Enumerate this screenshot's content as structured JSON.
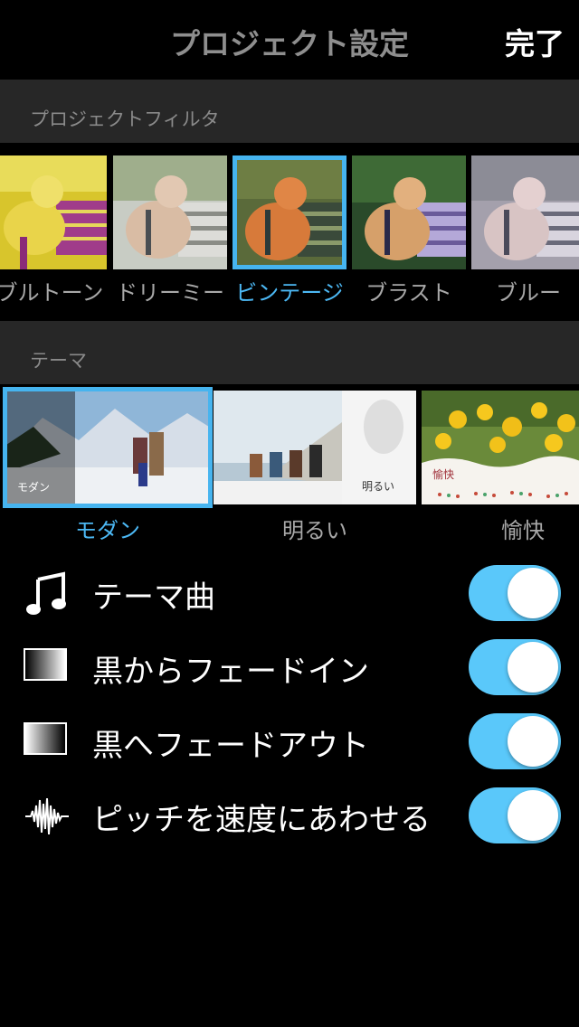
{
  "nav": {
    "title": "プロジェクト設定",
    "done_label": "完了"
  },
  "filters": {
    "header": "プロジェクトフィルタ",
    "selected": "ビンテージ",
    "items": [
      {
        "label": "ブルトーン",
        "icon": "duotone-dog-thumbnail"
      },
      {
        "label": "ドリーミー",
        "icon": "dreamy-dog-thumbnail"
      },
      {
        "label": "ビンテージ",
        "icon": "vintage-dog-thumbnail"
      },
      {
        "label": "ブラスト",
        "icon": "blast-dog-thumbnail"
      },
      {
        "label": "ブルー",
        "icon": "blue-dog-thumbnail"
      }
    ]
  },
  "themes": {
    "header": "テーマ",
    "selected": "モダン",
    "items": [
      {
        "label": "モダン",
        "badge": "モダン",
        "icon": "modern-theme-thumbnail"
      },
      {
        "label": "明るい",
        "badge": "明るい",
        "icon": "bright-theme-thumbnail"
      },
      {
        "label": "愉快",
        "badge": "愉快",
        "icon": "playful-theme-thumbnail"
      }
    ]
  },
  "settings": [
    {
      "label": "テーマ曲",
      "icon": "music-note-icon",
      "on": true
    },
    {
      "label": "黒からフェードイン",
      "icon": "fade-in-icon",
      "on": true
    },
    {
      "label": "黒へフェードアウト",
      "icon": "fade-out-icon",
      "on": true
    },
    {
      "label": "ピッチを速度にあわせる",
      "icon": "waveform-icon",
      "on": true
    }
  ],
  "colors": {
    "accent": "#46b4ef",
    "toggle_on": "#5ac8fa",
    "section_bg": "#272727"
  }
}
